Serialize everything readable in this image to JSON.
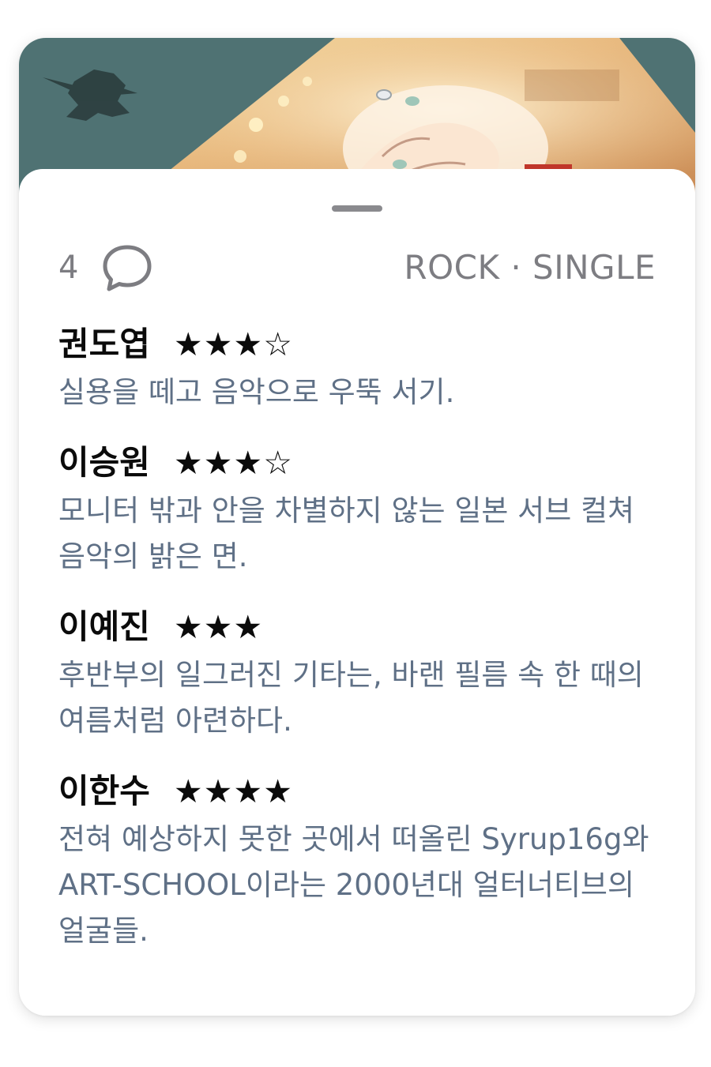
{
  "header": {
    "comment_count": "4",
    "genre": "ROCK · SINGLE"
  },
  "icons": {
    "comment": "speech-bubble-icon"
  },
  "colors": {
    "art_background": "#4f7273",
    "comment_text": "#5f7086",
    "meta_text": "#7d7d82",
    "name_text": "#0b0b0b"
  },
  "reviews": [
    {
      "name": "권도엽",
      "stars": "★★★☆",
      "text": "실용을 떼고 음악으로 우뚝 서기."
    },
    {
      "name": "이승원",
      "stars": "★★★☆",
      "text": "모니터 밖과 안을 차별하지 않는 일본 서브 컬쳐 음악의 밝은 면."
    },
    {
      "name": "이예진",
      "stars": "★★★",
      "text": "후반부의 일그러진 기타는, 바랜 필름 속 한 때의 여름처럼 아련하다."
    },
    {
      "name": "이한수",
      "stars": "★★★★",
      "text": "전혀 예상하지 못한 곳에서 떠올린 Syrup16g와 ART-SCHOOL이라는 2000년대 얼터너티브의 얼굴들."
    }
  ]
}
